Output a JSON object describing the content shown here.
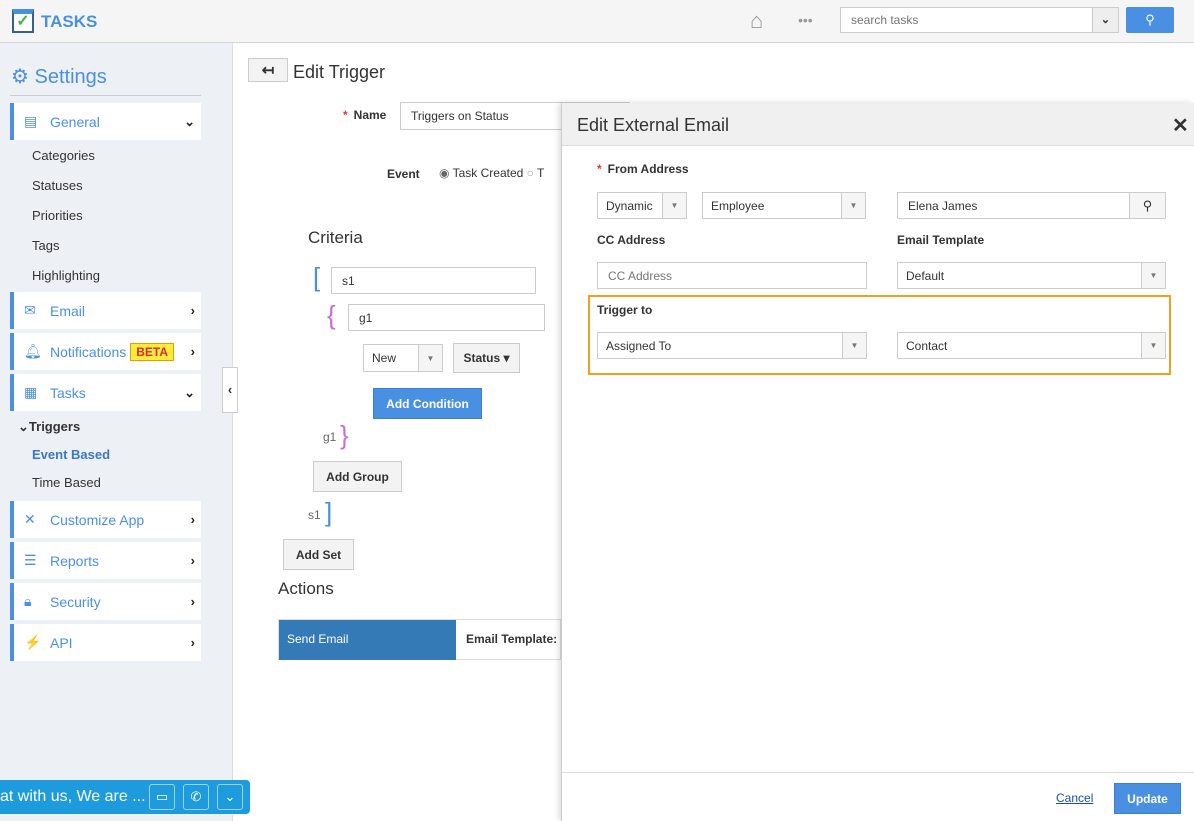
{
  "app": {
    "title": "TASKS",
    "search_placeholder": "search tasks",
    "more": "•••"
  },
  "sidebar": {
    "title": "Settings",
    "general": {
      "label": "General",
      "items": [
        "Categories",
        "Statuses",
        "Priorities",
        "Tags",
        "Highlighting"
      ]
    },
    "email": "Email",
    "notifications": "Notifications",
    "beta": "BETA",
    "tasks": {
      "label": "Tasks",
      "triggers": "Triggers",
      "event_based": "Event Based",
      "time_based": "Time Based"
    },
    "customize": "Customize App",
    "reports": "Reports",
    "security": "Security",
    "api": "API"
  },
  "trigger": {
    "title": "Edit Trigger",
    "name_label": "Name",
    "name_value": "Triggers on Status",
    "event_label": "Event",
    "event_option": "Task Created",
    "event_option2": "T",
    "criteria": "Criteria",
    "set": "s1",
    "group": "g1",
    "cond_value": "New",
    "cond_field": "Status",
    "add_condition": "Add Condition",
    "add_group": "Add Group",
    "add_set": "Add Set",
    "actions": "Actions",
    "action_name": "Send Email",
    "action_template": "Email Template:"
  },
  "modal": {
    "title": "Edit External Email",
    "from_label": "From Address",
    "from_type": "Dynamic",
    "from_role": "Employee",
    "from_name": "Elena James",
    "cc_label": "CC Address",
    "cc_placeholder": "CC Address",
    "template_label": "Email Template",
    "template_value": "Default",
    "trigger_to_label": "Trigger to",
    "trigger_to_1": "Assigned To",
    "trigger_to_2": "Contact",
    "cancel": "Cancel",
    "update": "Update"
  },
  "chat": {
    "text": "at with us, We are ..."
  },
  "colors": {
    "accent": "#4a90e2",
    "highlight_border": "#f0a020",
    "action_bg": "#337ab7",
    "chat_bg": "#1e9bdc"
  }
}
